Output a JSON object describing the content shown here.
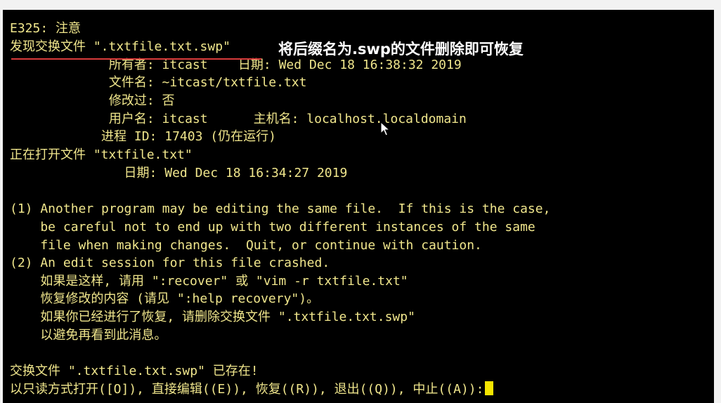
{
  "terminal": {
    "lines": [
      "E325: 注意",
      "发现交换文件 \".txtfile.txt.swp\"",
      "             所有者: itcast    日期: Wed Dec 18 16:38:32 2019",
      "             文件名: ~itcast/txtfile.txt",
      "             修改过: 否",
      "             用户名: itcast      主机名: localhost.localdomain",
      "            进程 ID: 17403 (仍在运行)",
      "正在打开文件 \"txtfile.txt\"",
      "               日期: Wed Dec 18 16:34:27 2019",
      "",
      "(1) Another program may be editing the same file.  If this is the case,",
      "    be careful not to end up with two different instances of the same",
      "    file when making changes.  Quit, or continue with caution.",
      "(2) An edit session for this file crashed.",
      "    如果是这样, 请用 \":recover\" 或 \"vim -r txtfile.txt\"",
      "    恢复修改的内容 (请见 \":help recovery\")。",
      "    如果你已经进行了恢复, 请删除交换文件 \".txtfile.txt.swp\"",
      "    以避免再看到此消息。",
      "",
      "交换文件 \".txtfile.txt.swp\" 已存在!",
      "以只读方式打开([O]), 直接编辑((E)), 恢复((R)), 退出((Q)), 中止((A)):"
    ],
    "text_color": "#f0e68c",
    "background_color": "#000000",
    "cursor_color": "#f5e500"
  },
  "annotation": {
    "caption": "将后缀名为.swp的文件删除即可恢复",
    "underline_color": "#d83b3b"
  }
}
